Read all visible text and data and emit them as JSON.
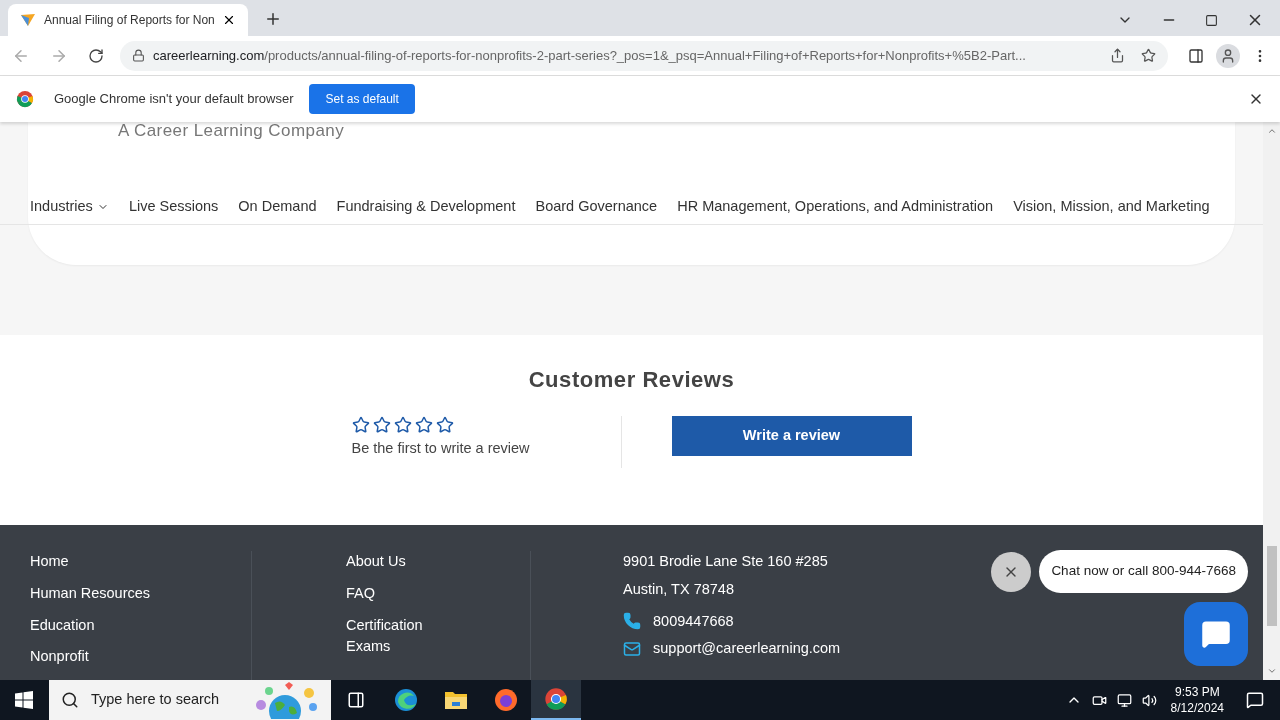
{
  "browser": {
    "tabs": [
      {
        "title": "Annual Filing of Reports for Non",
        "selected": true
      }
    ],
    "url_host": "careerlearning.com",
    "url_path": "/products/annual-filing-of-reports-for-nonprofits-2-part-series?_pos=1&_psq=Annual+Filing+of+Reports+for+Nonprofits+%5B2-Part...",
    "infobar": {
      "message": "Google Chrome isn't your default browser",
      "button": "Set as default"
    }
  },
  "header": {
    "tagline": "A Career Learning Company",
    "nav": [
      {
        "label": "Industries",
        "dropdown": true
      },
      {
        "label": "Live Sessions",
        "dropdown": false
      },
      {
        "label": "On Demand",
        "dropdown": false
      },
      {
        "label": "Fundraising & Development",
        "dropdown": false
      },
      {
        "label": "Board Governance",
        "dropdown": false
      },
      {
        "label": "HR Management, Operations, and Administration",
        "dropdown": false
      },
      {
        "label": "Vision, Mission, and Marketing",
        "dropdown": false
      }
    ]
  },
  "reviews": {
    "title": "Customer Reviews",
    "stars": 0,
    "prompt": "Be the first to write a review",
    "button": "Write a review"
  },
  "footer": {
    "links_1": [
      "Home",
      "Human Resources",
      "Education",
      "Nonprofit"
    ],
    "links_2": [
      "About Us",
      "FAQ",
      "Certification Exams"
    ],
    "address": [
      "9901 Brodie Lane Ste 160 #285",
      "Austin, TX 78748"
    ],
    "phone": "8009447668",
    "email": "support@careerlearning.com"
  },
  "chat": {
    "message": "Chat now or call 800-944-7668"
  },
  "taskbar": {
    "search_placeholder": "Type here to search",
    "time": "9:53 PM",
    "date": "8/12/2024"
  }
}
